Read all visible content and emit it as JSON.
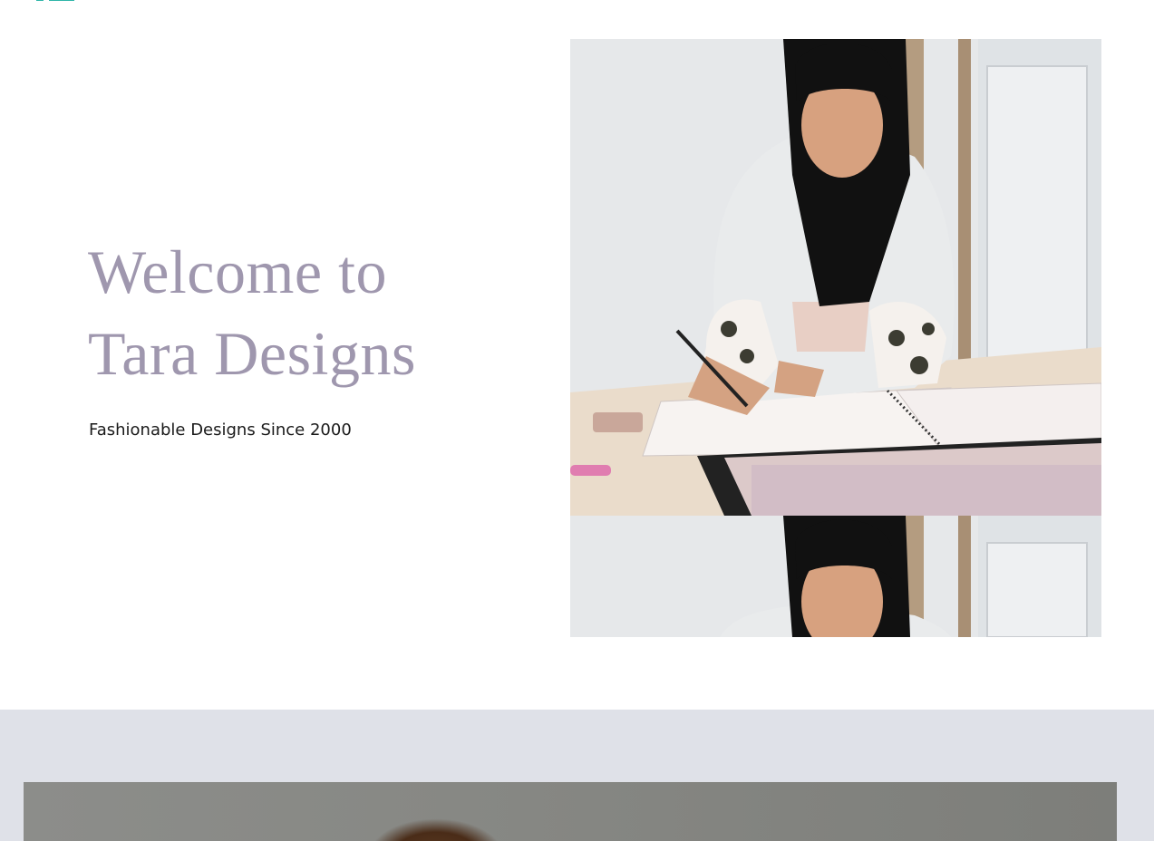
{
  "hero": {
    "title_line1": "Welcome to",
    "title_line2": "Tara Designs",
    "subtitle": "Fashionable Designs Since 2000"
  },
  "colors": {
    "title": "#9f97ae",
    "band_background": "#dfe1e8",
    "logo_accent": "#2fb5a8"
  },
  "images": {
    "hero_photo": "designer-sketching-photo",
    "band_photo": "model-photo"
  }
}
